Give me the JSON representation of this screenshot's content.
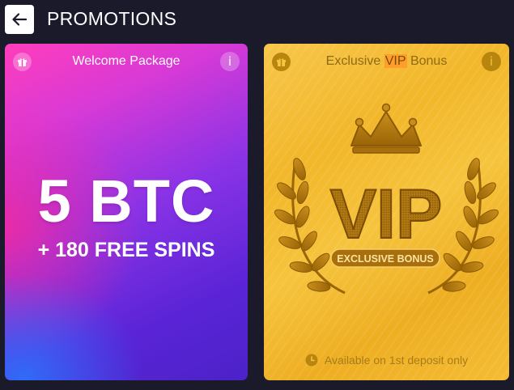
{
  "header": {
    "title": "PROMOTIONS",
    "back_icon": "arrow-left-icon"
  },
  "cards": [
    {
      "title": "Welcome Package",
      "headline": "5 BTC",
      "subline": "+ 180 FREE SPINS",
      "info_label": "i",
      "colors": {
        "start": "#ff3dbb",
        "mid": "#8a33e6",
        "end": "#4c22c9"
      }
    },
    {
      "title_prefix": "Exclusive ",
      "title_highlight": "VIP",
      "title_suffix": " Bonus",
      "vip_text": "VIP",
      "ribbon": "EXCLUSIVE BONUS",
      "footer": "Available on 1st deposit only",
      "info_label": "i",
      "colors": {
        "gold": "#f2b72a",
        "dark_gold": "#b8860d",
        "highlight": "#ff9e2c"
      }
    }
  ]
}
